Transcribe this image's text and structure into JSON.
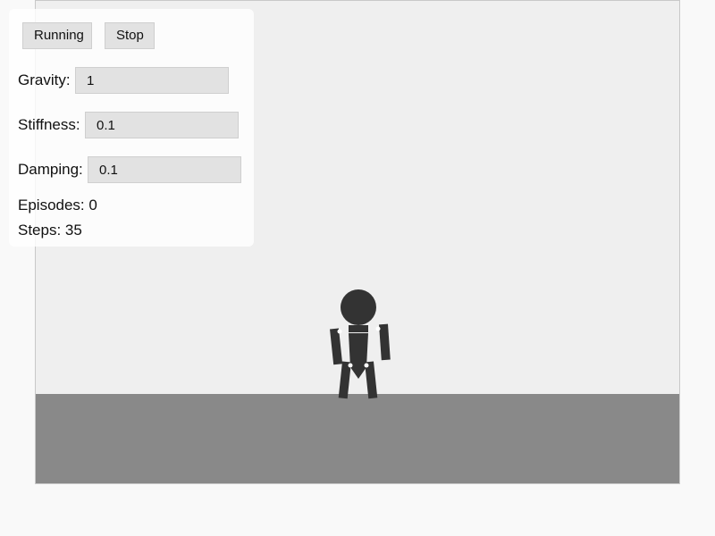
{
  "controls": {
    "running_label": "Running",
    "stop_label": "Stop"
  },
  "params": {
    "gravity": {
      "label": "Gravity:",
      "value": "1"
    },
    "stiffness": {
      "label": "Stiffness:",
      "value": "0.1"
    },
    "damping": {
      "label": "Damping:",
      "value": "0.1"
    }
  },
  "stats": {
    "episodes": "Episodes: 0",
    "steps": "Steps: 35"
  },
  "colors": {
    "sky": "#efefef",
    "ground": "#898989",
    "ragdoll": "#333333"
  }
}
